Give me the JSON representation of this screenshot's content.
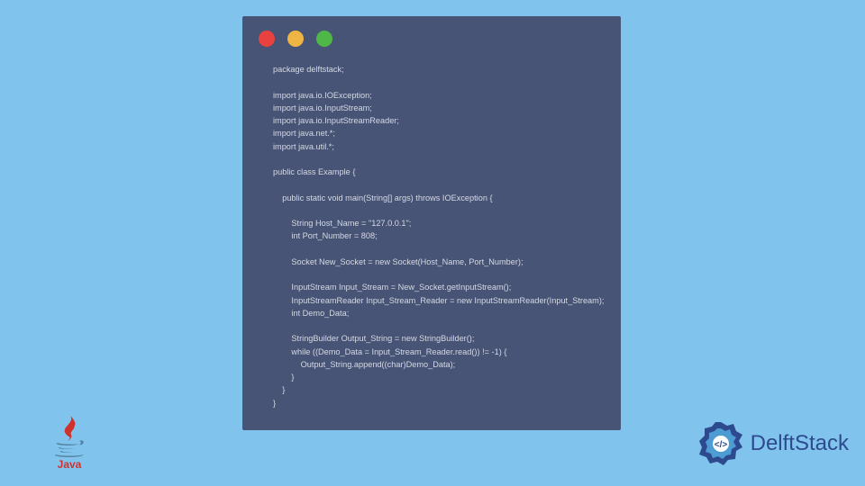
{
  "code": {
    "lines": "package delftstack;\n\nimport java.io.IOException;\nimport java.io.InputStream;\nimport java.io.InputStreamReader;\nimport java.net.*;\nimport java.util.*;\n\npublic class Example {\n\n    public static void main(String[] args) throws IOException {\n\n        String Host_Name = \"127.0.0.1\";\n        int Port_Number = 808;\n\n        Socket New_Socket = new Socket(Host_Name, Port_Number);\n\n        InputStream Input_Stream = New_Socket.getInputStream();\n        InputStreamReader Input_Stream_Reader = new InputStreamReader(Input_Stream);\n        int Demo_Data;\n\n        StringBuilder Output_String = new StringBuilder();\n        while ((Demo_Data = Input_Stream_Reader.read()) != -1) {\n            Output_String.append((char)Demo_Data);\n        }\n    }\n}"
  },
  "logos": {
    "java": "Java",
    "delftstack": "DelftStack"
  },
  "colors": {
    "background": "#80c4ed",
    "window": "#475475",
    "red": "#e8413f",
    "yellow": "#efb544",
    "green": "#4fb748",
    "logo_blue": "#2e4a8f"
  }
}
